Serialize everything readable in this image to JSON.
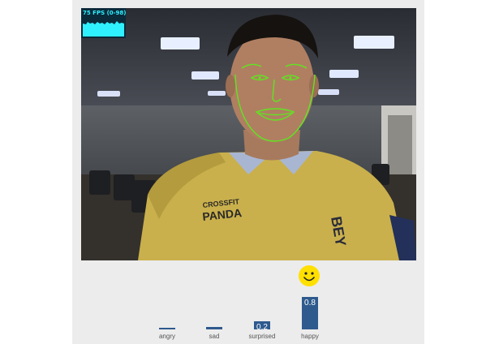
{
  "fps_meter": {
    "label": "75 FPS (0-98)",
    "text_color": "#2ff0ff",
    "background": "#0b2a3a"
  },
  "icons": {
    "emoji": "smiley-face-icon",
    "emoji_color": "#ffe000"
  },
  "chart_data": {
    "type": "bar",
    "categories": [
      "angry",
      "sad",
      "surprised",
      "happy"
    ],
    "values": [
      0.0,
      0.05,
      0.2,
      0.8
    ],
    "value_labels": [
      "",
      "",
      "0.2",
      "0.8"
    ],
    "ylim": [
      0,
      1
    ],
    "bar_color": "#2e5a8e",
    "title": "",
    "xlabel": "",
    "ylabel": ""
  }
}
